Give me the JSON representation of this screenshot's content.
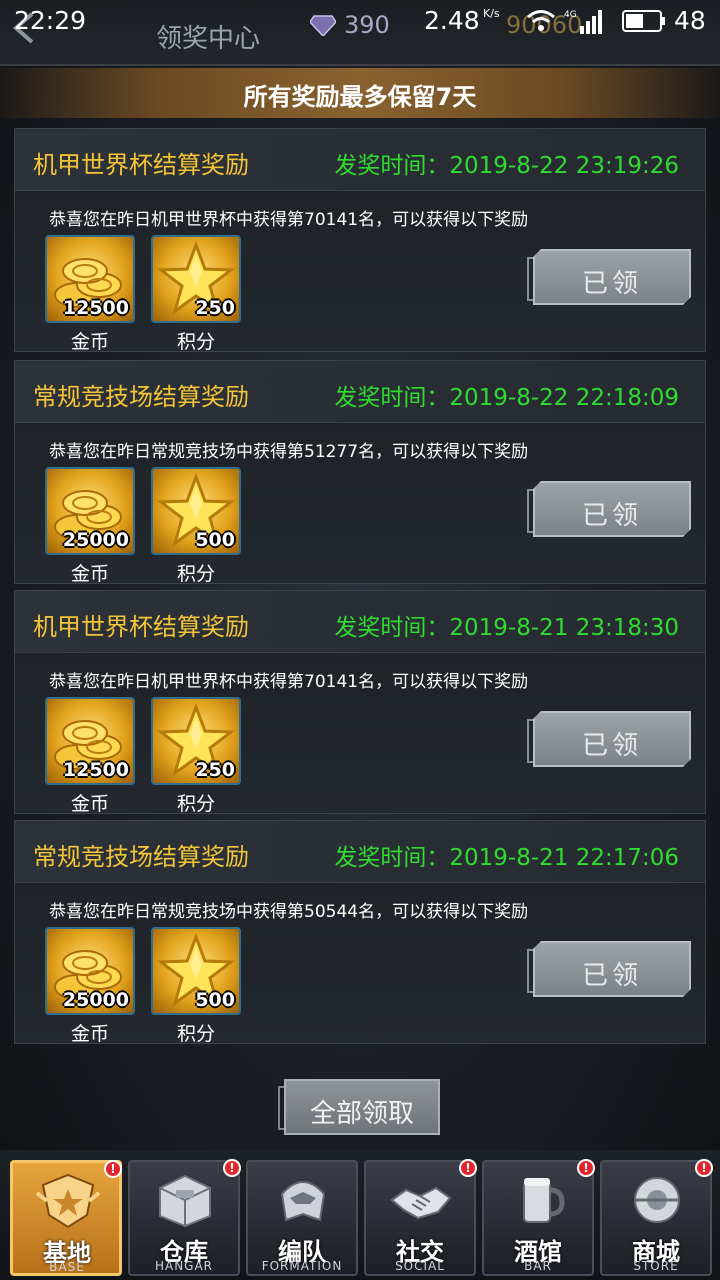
{
  "status_bar": {
    "time": "22:29",
    "net_speed": "2.48",
    "net_unit": "K/s",
    "signal": "4G",
    "battery": "48"
  },
  "header": {
    "title": "领奖中心",
    "gems": "390",
    "gold": "90060"
  },
  "notice": "所有奖励最多保留7天",
  "rewards": [
    {
      "title": "机甲世界杯结算奖励",
      "time": "发奖时间：2019-8-22 23:19:26",
      "desc": "恭喜您在昨日机甲世界杯中获得第70141名，可以获得以下奖励",
      "items": [
        {
          "qty": "12500",
          "name": "金币",
          "icon": "gold-coins-icon"
        },
        {
          "qty": "250",
          "name": "积分",
          "icon": "star-points-icon"
        }
      ],
      "button": "已领"
    },
    {
      "title": "常规竞技场结算奖励",
      "time": "发奖时间：2019-8-22 22:18:09",
      "desc": "恭喜您在昨日常规竞技场中获得第51277名，可以获得以下奖励",
      "items": [
        {
          "qty": "25000",
          "name": "金币",
          "icon": "gold-coins-icon"
        },
        {
          "qty": "500",
          "name": "积分",
          "icon": "star-points-icon"
        }
      ],
      "button": "已领"
    },
    {
      "title": "机甲世界杯结算奖励",
      "time": "发奖时间：2019-8-21 23:18:30",
      "desc": "恭喜您在昨日机甲世界杯中获得第70141名，可以获得以下奖励",
      "items": [
        {
          "qty": "12500",
          "name": "金币",
          "icon": "gold-coins-icon"
        },
        {
          "qty": "250",
          "name": "积分",
          "icon": "star-points-icon"
        }
      ],
      "button": "已领"
    },
    {
      "title": "常规竞技场结算奖励",
      "time": "发奖时间：2019-8-21 22:17:06",
      "desc": "恭喜您在昨日常规竞技场中获得第50544名，可以获得以下奖励",
      "items": [
        {
          "qty": "25000",
          "name": "金币",
          "icon": "gold-coins-icon"
        },
        {
          "qty": "500",
          "name": "积分",
          "icon": "star-points-icon"
        }
      ],
      "button": "已领"
    }
  ],
  "claim_all": "全部领取",
  "nav": [
    {
      "label": "基地",
      "sub": "BASE",
      "icon": "base-emblem-icon",
      "badge": "!"
    },
    {
      "label": "仓库",
      "sub": "HANGAR",
      "icon": "hangar-icon",
      "badge": "!"
    },
    {
      "label": "编队",
      "sub": "FORMATION",
      "icon": "mech-helmet-icon",
      "badge": ""
    },
    {
      "label": "社交",
      "sub": "SOCIAL",
      "icon": "handshake-icon",
      "badge": "!"
    },
    {
      "label": "酒馆",
      "sub": "BAR",
      "icon": "bar-mug-icon",
      "badge": "!"
    },
    {
      "label": "商城",
      "sub": "STORE",
      "icon": "store-orb-icon",
      "badge": "!"
    }
  ]
}
